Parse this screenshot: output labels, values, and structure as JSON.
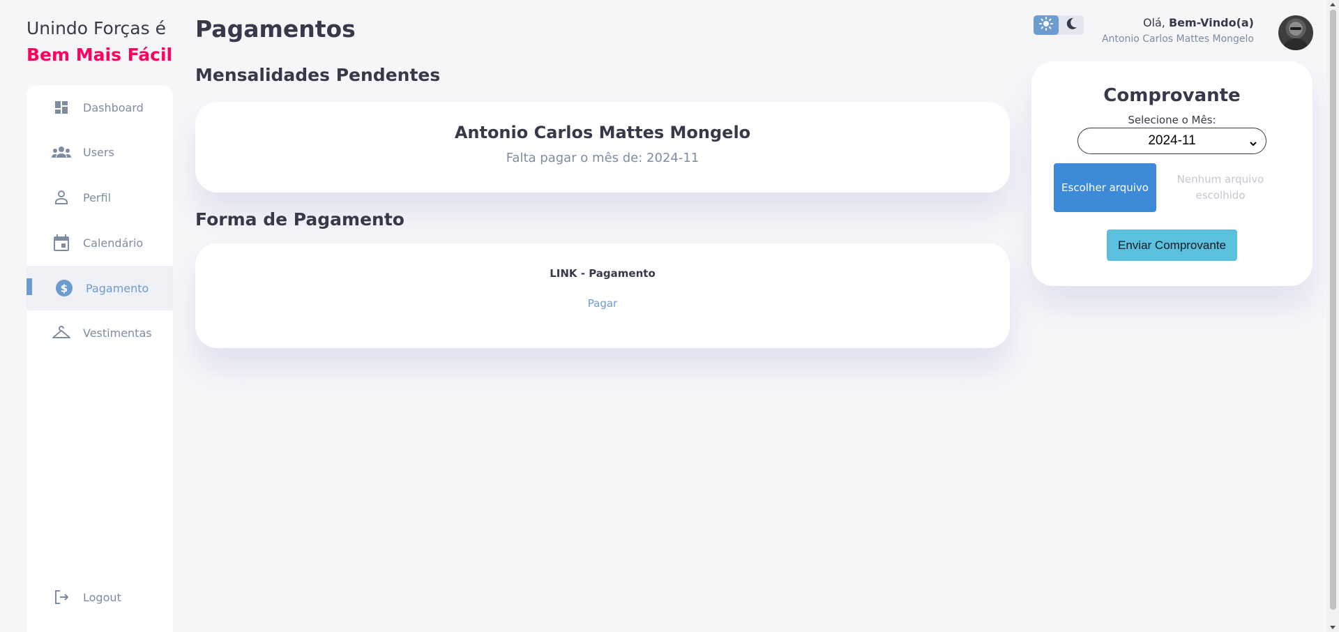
{
  "brand": {
    "line1": "Unindo Forças é",
    "line2": "Bem Mais Fácil",
    "line2_color": "#ff0060"
  },
  "sidebar": {
    "items": [
      {
        "label": "Dashboard",
        "icon": "dashboard-icon",
        "active": false
      },
      {
        "label": "Users",
        "icon": "users-icon",
        "active": false
      },
      {
        "label": "Perfil",
        "icon": "person-icon",
        "active": false
      },
      {
        "label": "Calendário",
        "icon": "calendar-icon",
        "active": false
      },
      {
        "label": "Pagamento",
        "icon": "dollar-icon",
        "active": true
      },
      {
        "label": "Vestimentas",
        "icon": "hanger-icon",
        "active": false
      }
    ],
    "logout": {
      "label": "Logout",
      "icon": "logout-icon"
    }
  },
  "main": {
    "title": "Pagamentos",
    "pending": {
      "heading": "Mensalidades Pendentes",
      "name": "Antonio Carlos Mattes Mongelo",
      "message": "Falta pagar o mês de: 2024-11"
    },
    "payment": {
      "heading": "Forma de Pagamento",
      "link_title": "LINK - Pagamento",
      "link_label": "Pagar"
    }
  },
  "header": {
    "theme": {
      "light_icon": "sun-icon",
      "dark_icon": "moon-icon",
      "active": "light"
    },
    "greeting_prefix": "Olá, ",
    "greeting_bold": "Bem-Vindo(a)",
    "user_name": "Antonio Carlos Mattes Mongelo"
  },
  "comprovante": {
    "title": "Comprovante",
    "month_label": "Selecione o Mês:",
    "month_selected": "2024-11",
    "file_button": "Escolher arquivo",
    "file_status": "Nenhum arquivo escolhido",
    "submit_label": "Enviar Comprovante"
  },
  "colors": {
    "accent": "#6c9bcf",
    "danger": "#ff0060",
    "background": "#f6f6f9",
    "file_button": "#3c8ad8",
    "submit_button": "#5bc0de"
  }
}
